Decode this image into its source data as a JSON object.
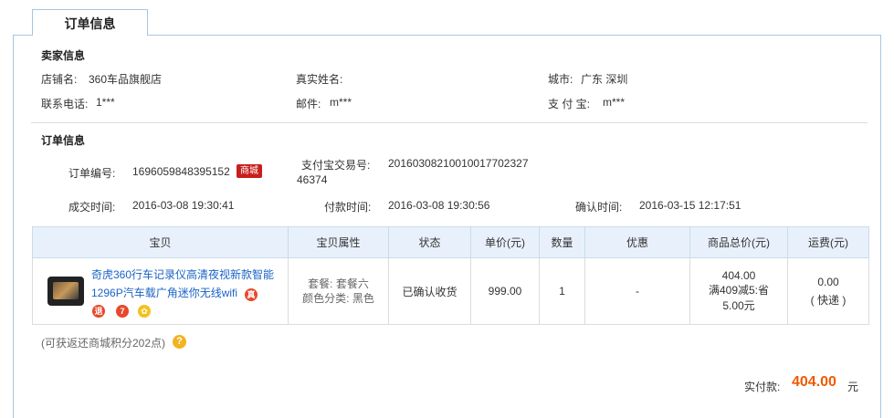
{
  "tab_title": "订单信息",
  "seller": {
    "section_title": "卖家信息",
    "shop_name_label": "店铺名:",
    "shop_name": "360车品旗舰店",
    "real_name_label": "真实姓名:",
    "real_name": "",
    "city_label": "城市:",
    "city": "广东 深圳",
    "phone_label": "联系电话:",
    "phone": "1***",
    "email_label": "邮件:",
    "email": "m***",
    "alipay_label": "支 付 宝:",
    "alipay": "m***"
  },
  "order": {
    "section_title": "订单信息",
    "order_no_label": "订单编号:",
    "order_no": "1696059848395152",
    "tmall_badge": "商城",
    "alipay_trade_label": "支付宝交易号:",
    "alipay_trade_line1": "201603082100100177023​27",
    "alipay_trade_line2": "46374",
    "deal_time_label": "成交时间:",
    "deal_time": "2016-03-08 19:30:41",
    "pay_time_label": "付款时间:",
    "pay_time": "2016-03-08 19:30:56",
    "confirm_time_label": "确认时间:",
    "confirm_time": "2016-03-15 12:17:51"
  },
  "table": {
    "headers": [
      "宝贝",
      "宝贝属性",
      "状态",
      "单价(元)",
      "数量",
      "优惠",
      "商品总价(元)",
      "运费(元)"
    ],
    "row": {
      "title": "奇虎360行车记录仪高清夜视新款智能1296P汽车载广角迷你无线wifi",
      "attr_line1": "套餐: 套餐六",
      "attr_line2": "颜色分类: 黑色",
      "status": "已确认收货",
      "price": "999.00",
      "qty": "1",
      "discount": "-",
      "total_line1": "404.00",
      "total_line2": "满409减5:省",
      "total_line3": "5.00元",
      "shipping_line1": "0.00",
      "shipping_line2": "( 快递 )"
    }
  },
  "points_note": "(可获返还商城积分202点)",
  "payment": {
    "label": "实付款:",
    "amount": "404.00",
    "unit": "元"
  },
  "colors": {
    "accent_border": "#a6c6e2",
    "table_header_bg": "#e8f1fb",
    "link": "#1a63c6",
    "amount": "#f05a00",
    "tmall_red": "#c81e1e"
  }
}
